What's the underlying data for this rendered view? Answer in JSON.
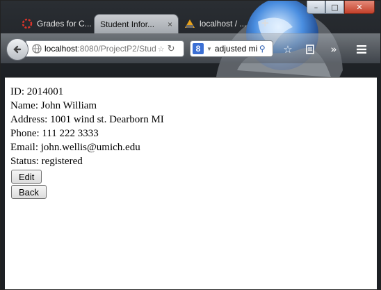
{
  "tabs": [
    {
      "label": "Grades for C...",
      "active": false
    },
    {
      "label": "Student Infor...",
      "active": true
    },
    {
      "label": "localhost / ...",
      "active": false
    }
  ],
  "tab_close_glyph": "×",
  "new_tab_glyph": "+",
  "window_controls": {
    "minimize": "–",
    "maximize": "□",
    "close": "✕"
  },
  "url": {
    "host": "localhost",
    "path": ":8080/ProjectP2/Stud"
  },
  "search": {
    "engine_letter": "8",
    "value": "adjusted mi"
  },
  "student": {
    "id_label": "ID:",
    "id": "2014001",
    "name_label": "Name:",
    "name": "John William",
    "address_label": "Address:",
    "address": "1001 wind st. Dearborn MI",
    "phone_label": "Phone:",
    "phone": "111 222 3333",
    "email_label": "Email:",
    "email": "john.wellis@umich.edu",
    "status_label": "Status:",
    "status": "registered"
  },
  "buttons": {
    "edit": "Edit",
    "back": "Back"
  },
  "colors": {
    "grades_favicon": "#d9342b",
    "globe_blue": "#2f6fc9"
  }
}
